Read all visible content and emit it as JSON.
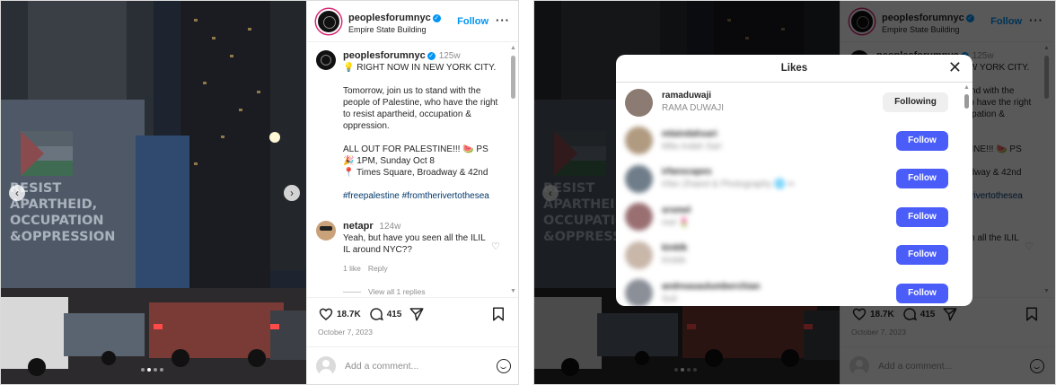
{
  "post": {
    "username": "peoplesforumnyc",
    "location": "Empire State Building",
    "follow_label": "Follow",
    "more_label": "···",
    "photo": {
      "building_text_lines": [
        "RESIST",
        "APARTHEID,",
        "OCCUPATION",
        "&OPPRESSION"
      ],
      "carousel_prev": "‹",
      "carousel_next": "›"
    },
    "caption": {
      "username": "peoplesforumnyc",
      "time": "125w",
      "line1": "💡 RIGHT NOW IN NEW YORK CITY.",
      "para2": "Tomorrow, join us to stand with the people of Palestine, who have the right to resist apartheid, occupation & oppression.",
      "line3": "ALL OUT FOR PALESTINE!!! 🍉 PS",
      "line4": "🎉 1PM, Sunday Oct 8",
      "line5": "📍 Times Square, Broadway & 42nd",
      "hashtags": "#freepalestine #fromtherivertothesea"
    },
    "comment": {
      "username": "netapr",
      "time": "124w",
      "text": "Yeah, but have you seen all the ILIL IL around NYC??",
      "likes": "1 like",
      "reply": "Reply",
      "view_replies": "View all 1 replies"
    },
    "likes_count": "18.7K",
    "comments_count": "415",
    "date": "October 7, 2023",
    "add_comment_placeholder": "Add a comment..."
  },
  "likes_modal": {
    "title": "Likes",
    "close": "✕",
    "users": [
      {
        "username": "ramaduwaji",
        "name": "RAMA DUWAJI",
        "button": "Following",
        "blurred": false,
        "avatar_color": "#8c7b72"
      },
      {
        "username": "mlaindahsari",
        "name": "Mlia Indah Sari",
        "button": "Follow",
        "blurred": true,
        "avatar_color": "#b09a80"
      },
      {
        "username": "irfanscapes",
        "name": "Irfan Zhaeel & Photography 🌐 ▪▪",
        "button": "Follow",
        "blurred": true,
        "avatar_color": "#6f7d8a"
      },
      {
        "username": "srsmel",
        "name": "mel 🌷",
        "button": "Follow",
        "blurred": true,
        "avatar_color": "#9a6f72"
      },
      {
        "username": "kinklk",
        "name": "Kinkik",
        "button": "Follow",
        "blurred": true,
        "avatar_color": "#c9b7aa"
      },
      {
        "username": "andreasaulumberchian",
        "name": "Suli",
        "button": "Follow",
        "blurred": true,
        "avatar_color": "#8a8f98"
      }
    ]
  },
  "colors": {
    "accent": "#0095f6",
    "follow_button": "#4a5df9",
    "overlay": "rgba(0,0,0,0.65)"
  }
}
